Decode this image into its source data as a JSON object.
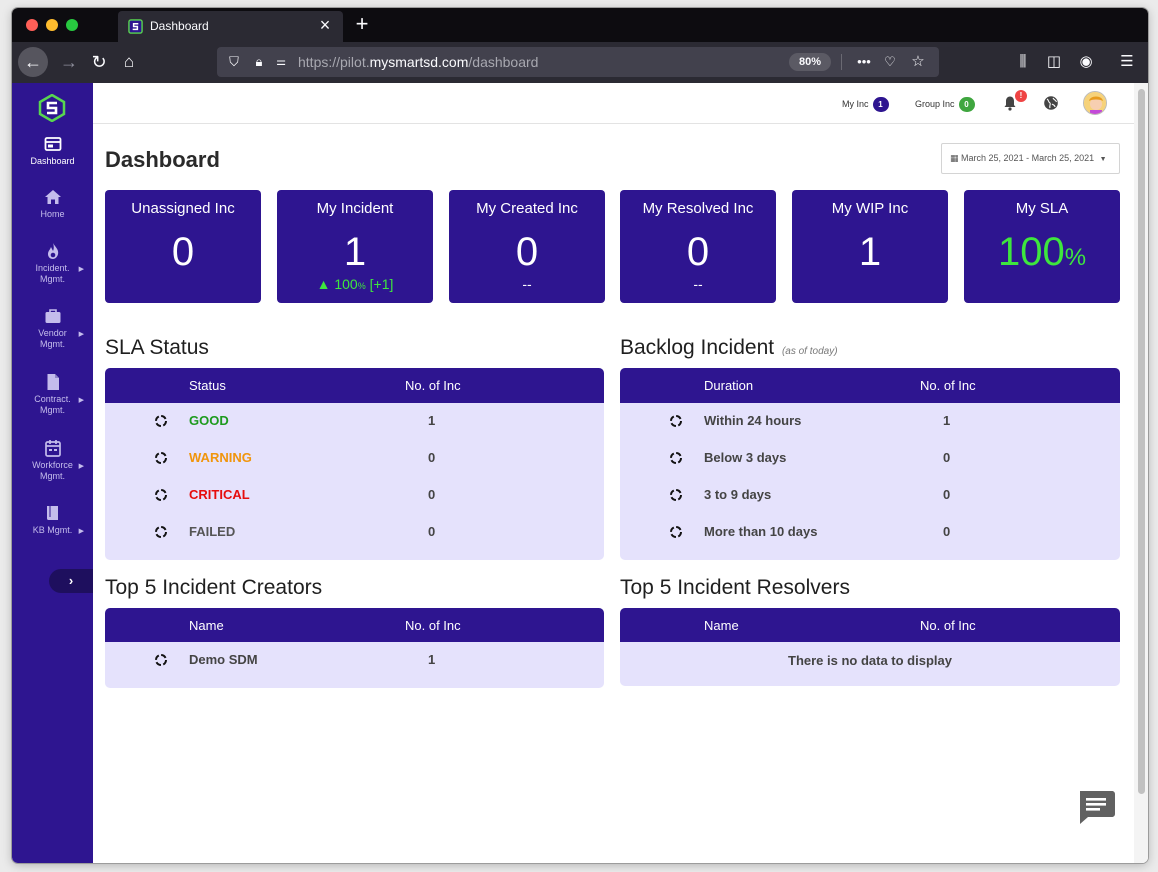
{
  "browser": {
    "tab_title": "Dashboard",
    "url_prefix": "https://pilot.",
    "url_host": "mysmartsd.com",
    "url_path": "/dashboard",
    "zoom": "80%"
  },
  "topbar": {
    "my_inc_label": "My Inc",
    "my_inc_count": "1",
    "group_inc_label": "Group Inc",
    "group_inc_count": "0",
    "notification_badge": "!"
  },
  "sidebar": {
    "items": [
      {
        "label": "Dashboard",
        "icon": "dashboard-icon"
      },
      {
        "label": "Home",
        "icon": "home-icon"
      },
      {
        "label": "Incident. Mgmt.",
        "icon": "fire-icon"
      },
      {
        "label": "Vendor Mgmt.",
        "icon": "briefcase-icon"
      },
      {
        "label": "Contract. Mgmt.",
        "icon": "document-icon"
      },
      {
        "label": "Workforce Mgmt.",
        "icon": "calendar-icon"
      },
      {
        "label": "KB Mgmt.",
        "icon": "book-icon"
      }
    ],
    "toggle": "›"
  },
  "page": {
    "title": "Dashboard",
    "date_range": "March 25, 2021 - March 25, 2021"
  },
  "cards": [
    {
      "title": "Unassigned Inc",
      "value": "0",
      "sub": ""
    },
    {
      "title": "My Incident",
      "value": "1",
      "sub_prefix": "▲ 100",
      "sub_small": "%",
      "sub_suffix": " [+1]"
    },
    {
      "title": "My Created Inc",
      "value": "0",
      "sub": "--"
    },
    {
      "title": "My Resolved Inc",
      "value": "0",
      "sub": "--"
    },
    {
      "title": "My WIP Inc",
      "value": "1",
      "sub": ""
    },
    {
      "title": "My SLA",
      "value": "100",
      "value_unit": "%"
    }
  ],
  "sla_status": {
    "title": "SLA Status",
    "columns": [
      "Status",
      "No. of Inc"
    ],
    "rows": [
      {
        "status": "GOOD",
        "count": "1"
      },
      {
        "status": "WARNING",
        "count": "0"
      },
      {
        "status": "CRITICAL",
        "count": "0"
      },
      {
        "status": "FAILED",
        "count": "0"
      }
    ]
  },
  "backlog": {
    "title": "Backlog Incident",
    "note": "(as of today)",
    "columns": [
      "Duration",
      "No. of Inc"
    ],
    "rows": [
      {
        "duration": "Within 24 hours",
        "count": "1"
      },
      {
        "duration": "Below 3 days",
        "count": "0"
      },
      {
        "duration": "3 to 9 days",
        "count": "0"
      },
      {
        "duration": "More than 10 days",
        "count": "0"
      }
    ]
  },
  "creators": {
    "title": "Top 5 Incident Creators",
    "columns": [
      "Name",
      "No. of Inc"
    ],
    "rows": [
      {
        "name": "Demo SDM",
        "count": "1"
      }
    ]
  },
  "resolvers": {
    "title": "Top 5 Incident Resolvers",
    "columns": [
      "Name",
      "No. of Inc"
    ],
    "empty": "There is no data to display"
  },
  "colors": {
    "primary": "#2e1590",
    "panel_bg": "#e5e2fc",
    "good": "#1e9a1e",
    "warning": "#f0950c",
    "critical": "#e60d0d",
    "sla_green": "#3ee63e"
  }
}
